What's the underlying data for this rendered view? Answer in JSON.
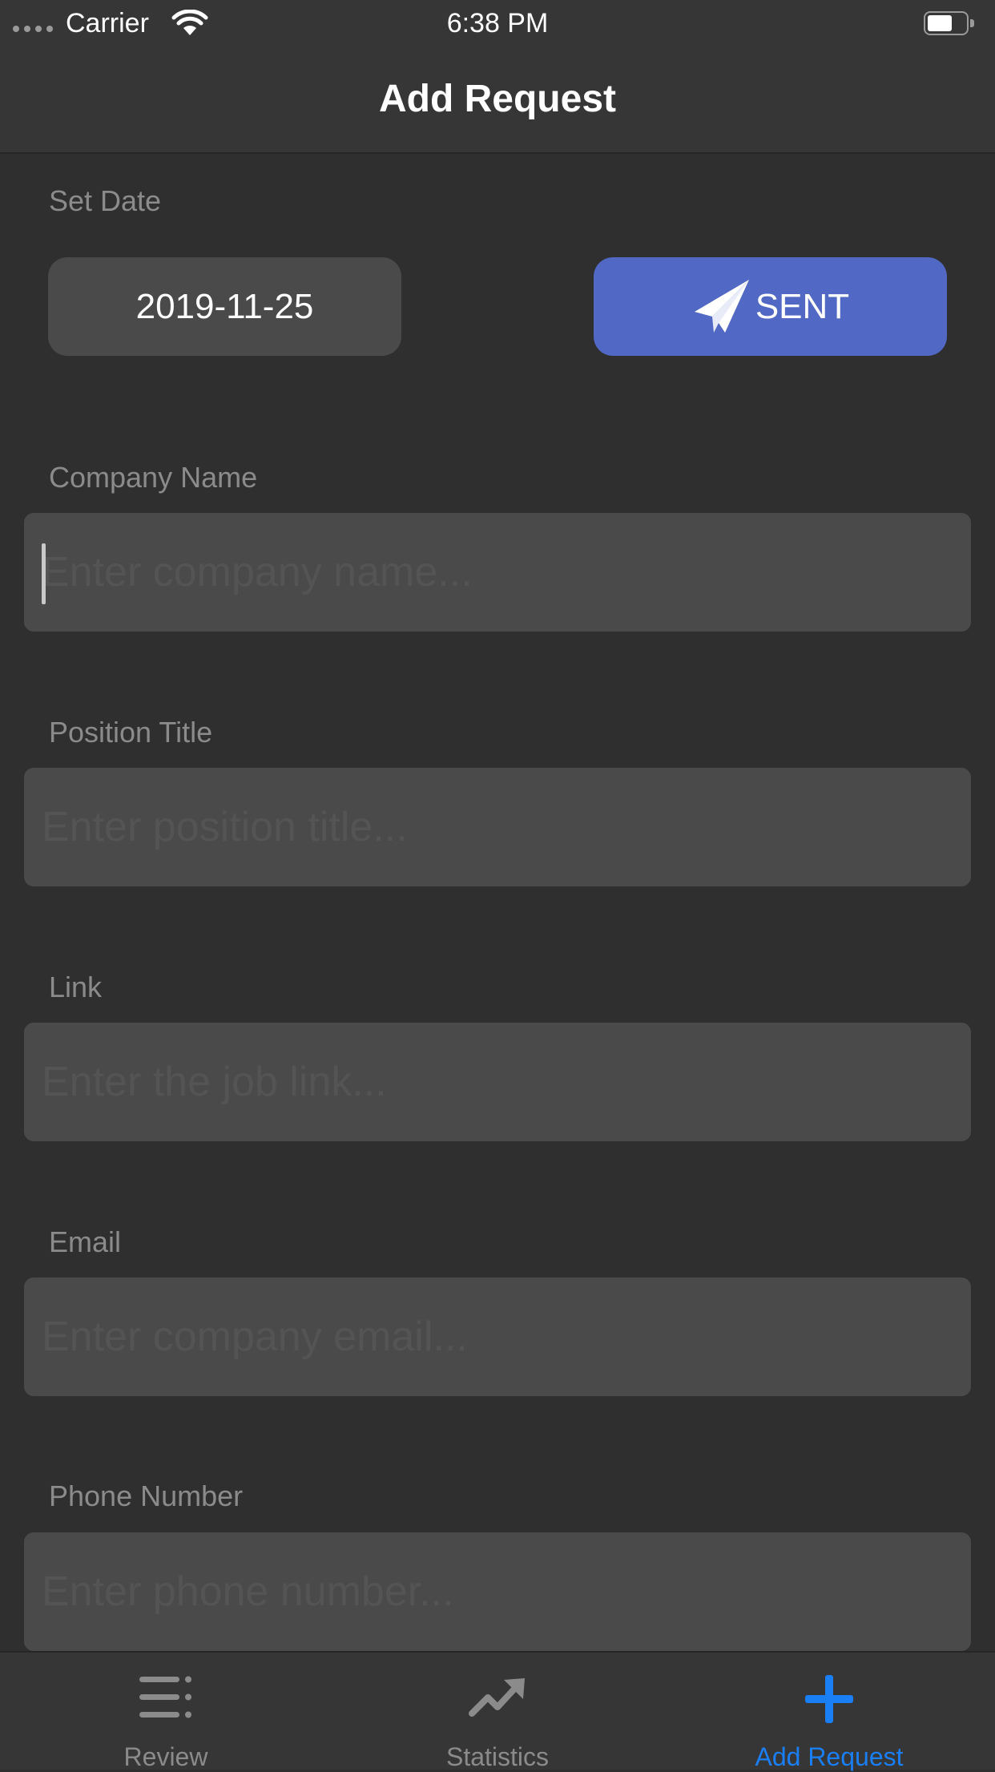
{
  "status_bar": {
    "carrier": "Carrier",
    "time": "6:38 PM"
  },
  "nav": {
    "title": "Add Request"
  },
  "date_section": {
    "label": "Set Date",
    "date_value": "2019-11-25",
    "sent_label": "SENT"
  },
  "fields": [
    {
      "label": "Company Name",
      "placeholder": "Enter company name...",
      "value": ""
    },
    {
      "label": "Position Title",
      "placeholder": "Enter position title...",
      "value": ""
    },
    {
      "label": "Link",
      "placeholder": "Enter the job link...",
      "value": ""
    },
    {
      "label": "Email",
      "placeholder": "Enter company email...",
      "value": ""
    },
    {
      "label": "Phone Number",
      "placeholder": "Enter phone number...",
      "value": ""
    }
  ],
  "tab_bar": {
    "items": [
      {
        "label": "Review",
        "icon": "list-icon",
        "selected": false
      },
      {
        "label": "Statistics",
        "icon": "trend-arrow-icon",
        "selected": false
      },
      {
        "label": "Add Request",
        "icon": "plus-icon",
        "selected": true
      }
    ]
  },
  "colors": {
    "background": "#2f2f2f",
    "bar_background": "#363636",
    "field_background": "#4a4a4a",
    "accent_button": "#5169c4",
    "tab_selected": "#1a7ef5",
    "tab_unselected": "#8b8b8b"
  }
}
